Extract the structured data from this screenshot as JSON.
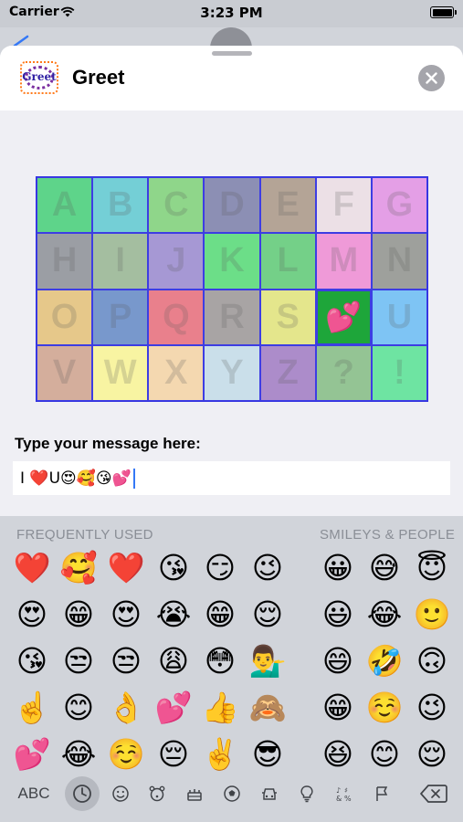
{
  "status_bar": {
    "carrier": "Carrier",
    "time": "3:23 PM",
    "icons": [
      "wifi-icon",
      "battery-icon"
    ]
  },
  "app": {
    "title": "Greet",
    "logo_text": "Greet",
    "close_icon": "close-icon"
  },
  "letter_grid": {
    "cells": [
      {
        "label": "A",
        "color": "#5ed48a"
      },
      {
        "label": "B",
        "color": "#74cfd6"
      },
      {
        "label": "C",
        "color": "#8fd68a"
      },
      {
        "label": "D",
        "color": "#8c8fb4"
      },
      {
        "label": "E",
        "color": "#b4a496"
      },
      {
        "label": "F",
        "color": "#ece0e6"
      },
      {
        "label": "G",
        "color": "#e49fe6"
      },
      {
        "label": "H",
        "color": "#9b9ea4"
      },
      {
        "label": "I",
        "color": "#a4bea0"
      },
      {
        "label": "J",
        "color": "#a698d4"
      },
      {
        "label": "K",
        "color": "#6cde88"
      },
      {
        "label": "L",
        "color": "#74d088"
      },
      {
        "label": "M",
        "color": "#ef9ad8"
      },
      {
        "label": "N",
        "color": "#9ea09c"
      },
      {
        "label": "O",
        "color": "#e6c88a"
      },
      {
        "label": "P",
        "color": "#7898cc"
      },
      {
        "label": "Q",
        "color": "#e9808c"
      },
      {
        "label": "R",
        "color": "#a8a4a4"
      },
      {
        "label": "S",
        "color": "#e4e68c"
      },
      {
        "label": "",
        "color": "#1ea63a",
        "emoji": "💕"
      },
      {
        "label": "U",
        "color": "#7ec4f4"
      },
      {
        "label": "V",
        "color": "#d4ae9c"
      },
      {
        "label": "W",
        "color": "#f8f4a2"
      },
      {
        "label": "X",
        "color": "#f4d8b0"
      },
      {
        "label": "Y",
        "color": "#cadfea"
      },
      {
        "label": "Z",
        "color": "#ac8cca"
      },
      {
        "label": "?",
        "color": "#94c494"
      },
      {
        "label": "!",
        "color": "#6ee4a2"
      }
    ]
  },
  "message": {
    "prompt": "Type your message here:",
    "value": "I ❤️U😍🥰😘💕"
  },
  "keyboard": {
    "section_frequent": "FREQUENTLY USED",
    "section_smileys": "SMILEYS & PEOPLE",
    "frequent": [
      [
        "❤️",
        "🥰",
        "❤️",
        "😘",
        "😏",
        "😉"
      ],
      [
        "😍",
        "😁",
        "😍",
        "😭",
        "😁",
        "😌"
      ],
      [
        "😘",
        "😒",
        "😒",
        "😩",
        "😳",
        "💁‍♂️"
      ],
      [
        "☝️",
        "😊",
        "👌",
        "💕",
        "👍",
        "🙈"
      ],
      [
        "💕",
        "😂",
        "☺️",
        "😔",
        "✌️",
        "😎"
      ]
    ],
    "smileys": [
      [
        "😀",
        "😅",
        "😇"
      ],
      [
        "😃",
        "😂",
        "🙂"
      ],
      [
        "😄",
        "🤣",
        "🙃"
      ],
      [
        "😁",
        "☺️",
        "😉"
      ],
      [
        "😆",
        "😊",
        "😌"
      ]
    ],
    "abc_label": "ABC",
    "category_icons": [
      "recent-clock-icon",
      "smiley-icon",
      "animal-icon",
      "food-icon",
      "activity-ball-icon",
      "travel-car-icon",
      "objects-bulb-icon",
      "symbols-icon",
      "flags-icon"
    ],
    "backspace_icon": "backspace-icon"
  }
}
